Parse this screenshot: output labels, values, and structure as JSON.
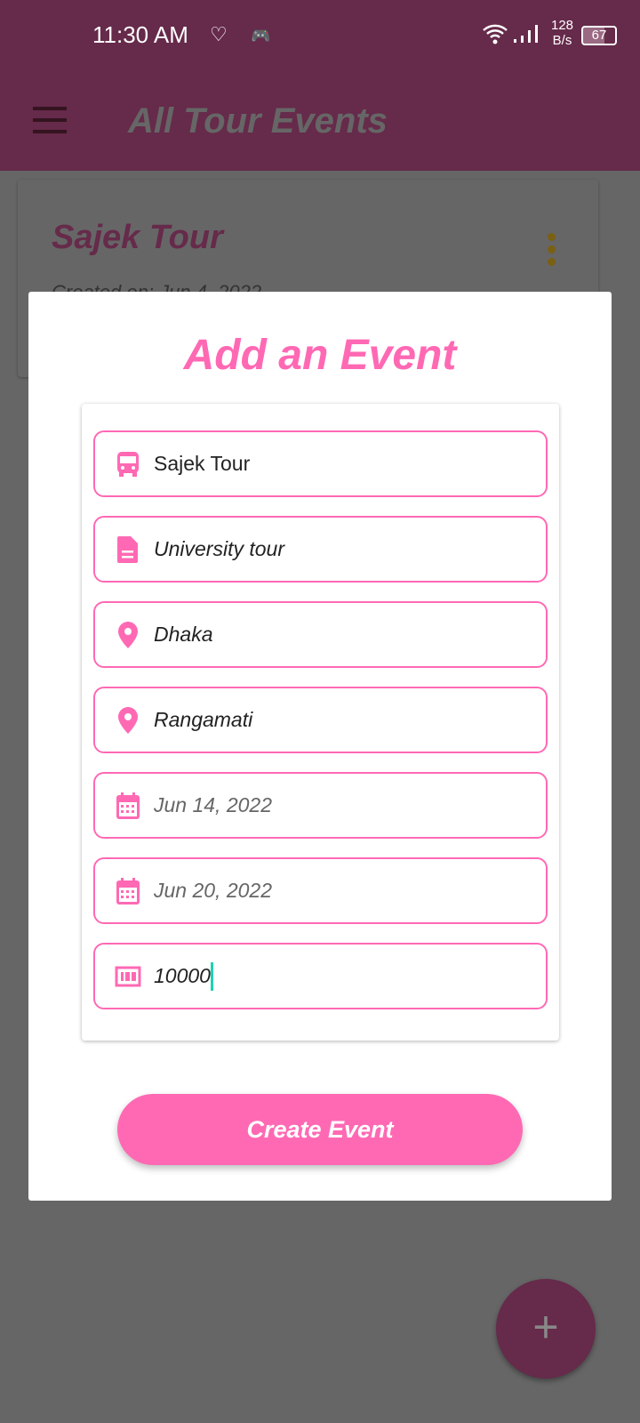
{
  "status": {
    "time": "11:30 AM",
    "speed_top": "128",
    "speed_bottom": "B/s",
    "battery": "67"
  },
  "appbar": {
    "title": "All Tour Events"
  },
  "card": {
    "title": "Sajek Tour",
    "subtitle": "Created on: Jun 4, 2022"
  },
  "dialog": {
    "title": "Add an Event",
    "fields": [
      {
        "icon": "bus-icon",
        "value": "Sajek Tour"
      },
      {
        "icon": "document-icon",
        "value": "University tour"
      },
      {
        "icon": "location-pin-icon",
        "value": "Dhaka"
      },
      {
        "icon": "location-pin-icon",
        "value": "Rangamati"
      },
      {
        "icon": "calendar-icon",
        "value": "Jun 14, 2022"
      },
      {
        "icon": "calendar-icon",
        "value": "Jun 20, 2022"
      },
      {
        "icon": "budget-icon",
        "value": "10000"
      }
    ],
    "button": "Create Event"
  },
  "fab": {
    "label": "+"
  },
  "colors": {
    "primary": "#662a4a",
    "accent": "#ff69b4"
  }
}
